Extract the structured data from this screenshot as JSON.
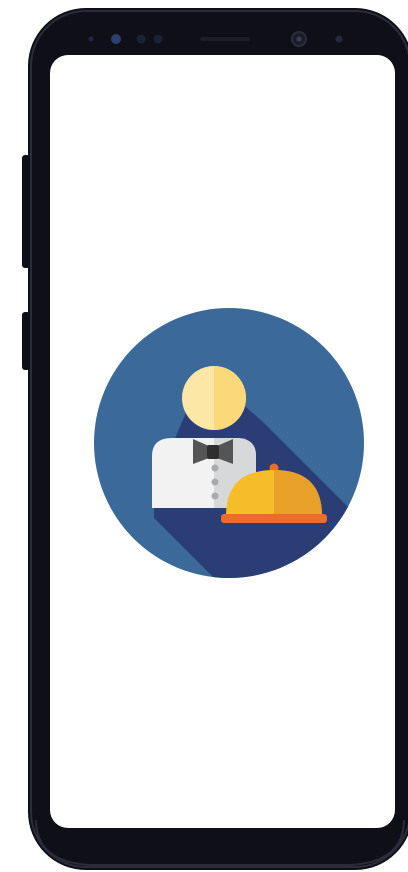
{
  "device": {
    "model": "smartphone",
    "frame_color": "#0e0f17",
    "bezel_highlight": "#2a2c3a"
  },
  "screen": {
    "background": "#ffffff",
    "state": "splash"
  },
  "splash": {
    "logo_icon": "waiter-with-serving-cloche-icon",
    "colors": {
      "circle": "#3b6a9a",
      "shadow": "#2b3d75",
      "head_light": "#fde7a6",
      "head_dark": "#fbd97b",
      "shirt": "#f2f2f2",
      "shirt_shade": "#d6d8da",
      "bowtie": "#555555",
      "buttons": "#a9aaab",
      "cloche": "#f5bd2a",
      "cloche_shade": "#e8a02b",
      "tray": "#ef6b2c"
    }
  }
}
